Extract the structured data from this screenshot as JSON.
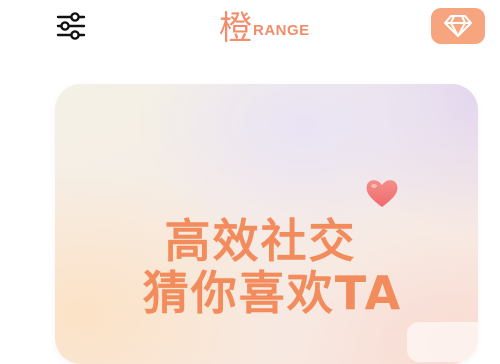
{
  "header": {
    "logo_cn": "橙",
    "logo_en": "RANGE",
    "filter_icon": "sliders-icon",
    "vip_icon": "diamond-icon",
    "vip_color": "#f7a57e"
  },
  "banner": {
    "headline_line1": "高效社交",
    "headline_line2": "猜你喜欢TA",
    "accent_color": "#f28c5c",
    "heart_color": "#f27b78"
  }
}
